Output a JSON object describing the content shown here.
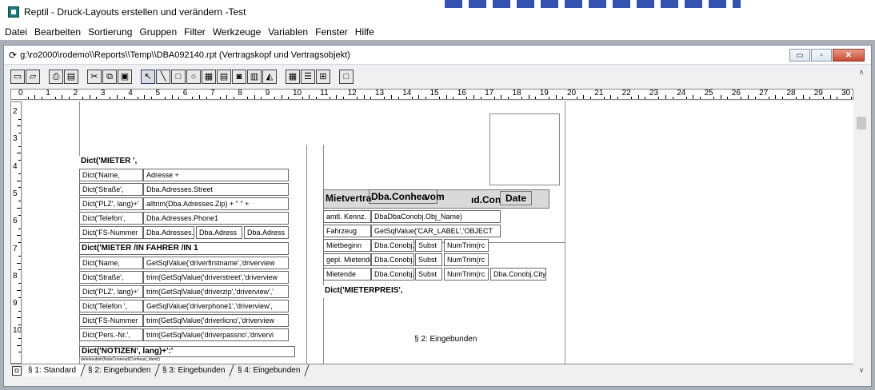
{
  "app": {
    "title": "Reptil - Druck-Layouts erstellen und verändern -Test",
    "menu": [
      "Datei",
      "Bearbeiten",
      "Sortierung",
      "Gruppen",
      "Filter",
      "Werkzeuge",
      "Variablen",
      "Fenster",
      "Hilfe"
    ]
  },
  "child_window": {
    "title": "g:\\ro2000\\rodemo\\\\Reports\\\\Temp\\\\DBA092140.rpt (Vertragskopf und Vertragsobjekt)",
    "controls": {
      "minimize": "▭",
      "restore": "▫",
      "close": "✕"
    }
  },
  "toolbar": {
    "icons": [
      "new-icon",
      "open-icon",
      "print-icon",
      "preview-icon",
      "cut-icon",
      "copy-icon",
      "paste-icon",
      "pointer-icon",
      "line-icon",
      "rectangle-icon",
      "ellipse-icon",
      "image-icon",
      "text-icon",
      "camera-icon",
      "table-icon",
      "chart-icon",
      "grid-icon",
      "list-icon",
      "columns-icon",
      "frame-icon"
    ]
  },
  "ruler": {
    "labels": [
      "0",
      "1",
      "2",
      "3",
      "4",
      "5",
      "6",
      "7",
      "8",
      "9",
      "10",
      "11",
      "12",
      "13",
      "14",
      "15",
      "16",
      "17",
      "18",
      "19",
      "20",
      "21",
      "22",
      "23",
      "24",
      "25",
      "26",
      "27",
      "28",
      "29",
      "30"
    ],
    "vlabels": [
      "2",
      "3",
      "4",
      "5",
      "6",
      "7",
      "8",
      "9",
      "10"
    ]
  },
  "report": {
    "mieter_header": "Dict('MIETER ',",
    "mieter_rows": [
      {
        "label": "Dict('Name,",
        "value": "Adresse +"
      },
      {
        "label": "Dict('Straße',",
        "value": "Dba.Adresses.Street"
      },
      {
        "label": "Dict('PLZ', lang)+'",
        "value": "alltrim(Dba.Adresses.Zip) + \" \" +"
      },
      {
        "label": "Dict('Telefon',",
        "value": "Dba.Adresses.Phone1"
      }
    ],
    "fs_row": {
      "label": "Dict('FS-Nummer",
      "v1": "Dba.Adresses.",
      "v2": "Dba.Adress",
      "v3": "Dba.Adress"
    },
    "fahrer_header": "Dict('MIETER /IN  FAHRER /IN 1",
    "fahrer_rows": [
      {
        "label": "Dict('Name,",
        "value": "GetSqlValue('driverfirstname','driverview"
      },
      {
        "label": "Dict('Straße',",
        "value": "trim(GetSqlValue('driverstreet','driverview"
      },
      {
        "label": "Dict('PLZ', lang)+'",
        "value": "trim(GetSqlValue('driverzip','driverview','"
      },
      {
        "label": "Dict('Telefon ',",
        "value": "GetSqlValue('driverphone1','driverview',"
      },
      {
        "label": "Dict('FS-Nummer",
        "value": "trim(GetSqlValue('driverlicno','driverview"
      },
      {
        "label": "Dict('Pers.-Nr.',",
        "value": "trim(GetSqlValue('driverpassno','drivervi"
      }
    ],
    "notizen_header": "Dict('NOTIZEN', lang)+':'",
    "notizen_small": "deletesubstr(NoteConnead(Conhead_Ident))",
    "mietvertrag": {
      "t1": "Mietvertrag",
      "t2": "Dba.Conhea",
      "t3": "vom",
      "t4": "ıd.Con",
      "t5": "Date"
    },
    "vehicle_rows": [
      {
        "label": "amtl. Kennz.",
        "value": "DbaDbaConobj.Obj_Name)"
      },
      {
        "label": "Fahrzeug",
        "value": "GetSqlValue('CAR_LABEL','OBJECT"
      }
    ],
    "period_rows": [
      {
        "label": "Mietbeginn",
        "c1": "Dba.Conobj.",
        "c2": "Subst",
        "c3": "NumTrim(rc"
      },
      {
        "label": "gepl. Mietende",
        "c1": "Dba.Conobj.",
        "c2": "Subst",
        "c3": "NumTrim(rc"
      },
      {
        "label": "Mietende",
        "c1": "Dba.Conobj.",
        "c2": "Subst",
        "c3": "NumTrim(rc",
        "c4": "Dba.Conobj.City"
      }
    ],
    "mieterpreis_header": "Dict('MIETERPREIS',",
    "section_caption": "§ 2: Eingebunden"
  },
  "tabs": [
    "§ 1: Standard",
    "§ 2: Eingebunden",
    "§ 3: Eingebunden",
    "§ 4: Eingebunden"
  ]
}
